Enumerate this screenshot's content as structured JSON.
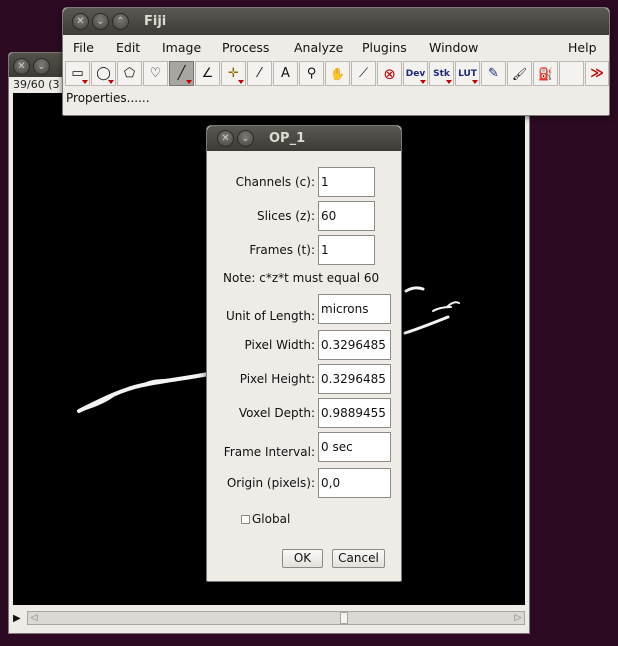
{
  "image_window": {
    "status": "39/60 (3"
  },
  "fiji": {
    "title": "Fiji",
    "menu": [
      "File",
      "Edit",
      "Image",
      "Process",
      "Analyze",
      "Plugins",
      "Window",
      "Help"
    ],
    "tools": [
      {
        "name": "rectangle-tool-icon",
        "glyph": "▭"
      },
      {
        "name": "oval-tool-icon",
        "glyph": "◯"
      },
      {
        "name": "polygon-tool-icon",
        "glyph": "⬠"
      },
      {
        "name": "freehand-tool-icon",
        "glyph": "♡"
      },
      {
        "name": "line-tool-icon",
        "glyph": "╱"
      },
      {
        "name": "angle-tool-icon",
        "glyph": "∠"
      },
      {
        "name": "point-tool-icon",
        "glyph": "✛"
      },
      {
        "name": "wand-tool-icon",
        "glyph": "⁄"
      },
      {
        "name": "text-tool-icon",
        "glyph": "A"
      },
      {
        "name": "magnifier-tool-icon",
        "glyph": "⚲"
      },
      {
        "name": "hand-tool-icon",
        "glyph": "✋"
      },
      {
        "name": "dropper-tool-icon",
        "glyph": "⟋"
      },
      {
        "name": "stop-icon",
        "glyph": "⊗"
      },
      {
        "name": "dev-tool-icon",
        "glyph": "Dev"
      },
      {
        "name": "stk-tool-icon",
        "glyph": "Stk"
      },
      {
        "name": "lut-tool-icon",
        "glyph": "LUT"
      },
      {
        "name": "pencil-tool-icon",
        "glyph": "✎"
      },
      {
        "name": "brush-tool-icon",
        "glyph": "🖌"
      },
      {
        "name": "flood-fill-tool-icon",
        "glyph": "⛽"
      },
      {
        "name": "blank-tool-slot",
        "glyph": ""
      },
      {
        "name": "more-tools-icon",
        "glyph": "≫"
      }
    ],
    "status_text": "Properties......"
  },
  "dialog": {
    "title": "OP_1",
    "channels_label": "Channels (c):",
    "channels_value": "1",
    "slices_label": "Slices (z):",
    "slices_value": "60",
    "frames_label": "Frames (t):",
    "frames_value": "1",
    "note": "Note: c*z*t must equal 60",
    "unit_label": "Unit of Length:",
    "unit_value": "microns",
    "pixel_width_label": "Pixel Width:",
    "pixel_width_value": "0.3296485",
    "pixel_height_label": "Pixel Height:",
    "pixel_height_value": "0.3296485",
    "voxel_depth_label": "Voxel Depth:",
    "voxel_depth_value": "0.9889455",
    "frame_interval_label": "Frame Interval:",
    "frame_interval_value": "0 sec",
    "origin_label": "Origin (pixels):",
    "origin_value": "0,0",
    "global_label": "Global",
    "ok_label": "OK",
    "cancel_label": "Cancel"
  },
  "colors": {
    "desktop": "#2c0a22",
    "window_bg": "#efebe7",
    "titlebar": "#3c3b37",
    "accent_red": "#c00000"
  }
}
